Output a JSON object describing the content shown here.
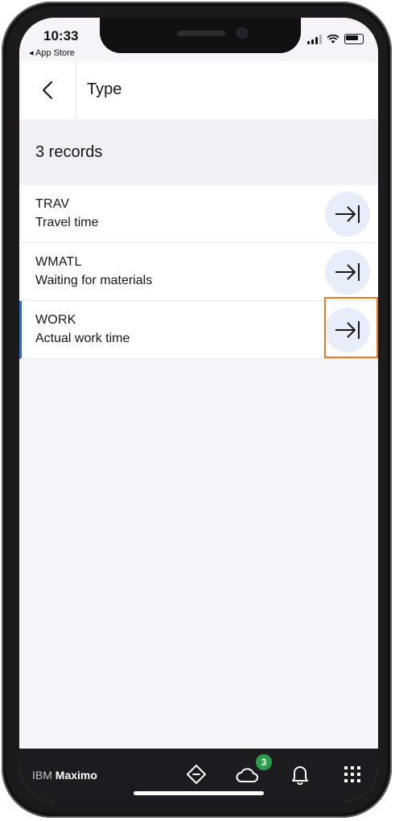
{
  "status_bar": {
    "time": "10:33",
    "back_app": "◂ App Store"
  },
  "header": {
    "title": "Type",
    "back_icon": "chevron-left-icon"
  },
  "records": {
    "count_label": "3 records"
  },
  "items": [
    {
      "code": "TRAV",
      "description": "Travel time",
      "action_icon": "arrow-right-to-line-icon"
    },
    {
      "code": "WMATL",
      "description": "Waiting for materials",
      "action_icon": "arrow-right-to-line-icon"
    },
    {
      "code": "WORK",
      "description": "Actual work time",
      "action_icon": "arrow-right-to-line-icon",
      "selected": true
    }
  ],
  "footer": {
    "brand_prefix": "IBM",
    "brand_name": "Maximo",
    "sync_badge": "3",
    "icons": [
      "navigate-icon",
      "cloud-icon",
      "bell-icon",
      "grid-menu-icon"
    ]
  },
  "colors": {
    "accent_blue": "#2a6bd8",
    "highlight_orange": "#e77b22",
    "badge_green": "#2a9d4b",
    "footer_bg": "#1c1b1f"
  }
}
